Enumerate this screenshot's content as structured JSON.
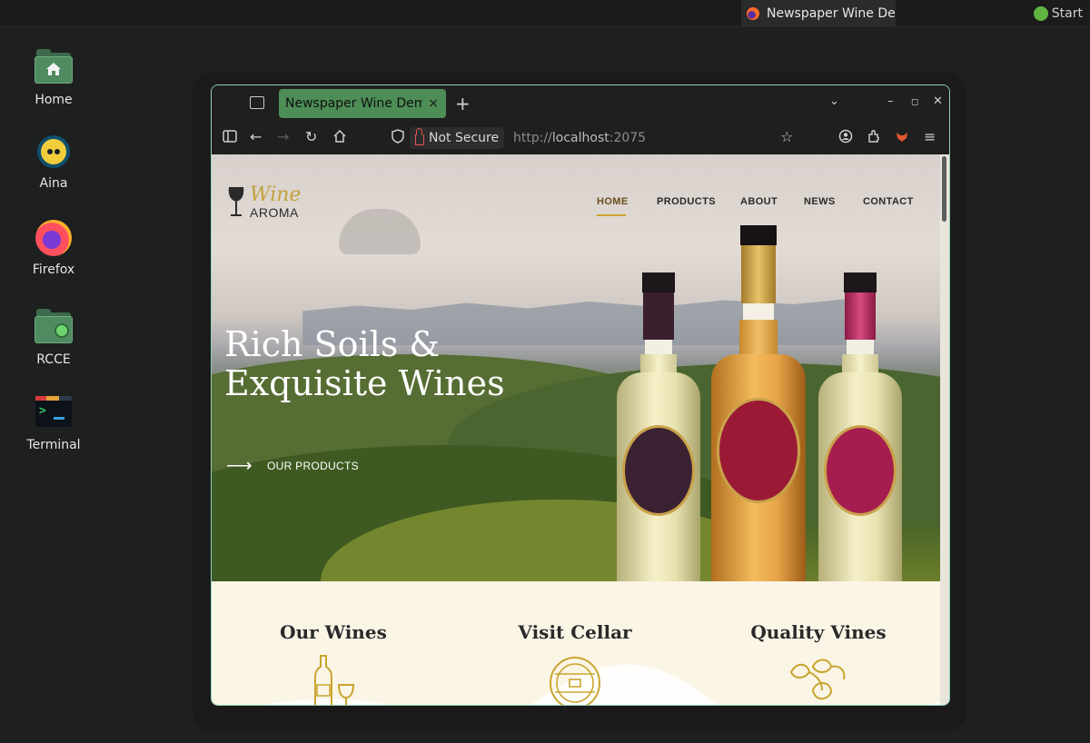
{
  "top_panel": {
    "taskbar_title": "Newspaper Wine De...",
    "start_label": "Start"
  },
  "desktop": {
    "icons": [
      {
        "label": "Home",
        "icon": "home-folder-icon"
      },
      {
        "label": "Aina",
        "icon": "aina-icon"
      },
      {
        "label": "Firefox",
        "icon": "firefox-icon"
      },
      {
        "label": "RCCE",
        "icon": "rcce-folder-icon"
      },
      {
        "label": "Terminal",
        "icon": "terminal-icon"
      }
    ]
  },
  "browser": {
    "tab_title": "Newspaper Wine Demo",
    "tab_close": "×",
    "new_tab": "+",
    "security_label": "Not Secure",
    "url_scheme": "http://",
    "url_host": "localhost",
    "url_port": ":2075",
    "accent": "#4d8d56"
  },
  "site": {
    "logo": {
      "word1": "Wine",
      "word2": "AROMA"
    },
    "nav": [
      "HOME",
      "PRODUCTS",
      "ABOUT",
      "NEWS",
      "CONTACT"
    ],
    "active_nav": "HOME",
    "hero": {
      "title_line1": "Rich Soils &",
      "title_line2": "Exquisite Wines",
      "cta": "OUR PRODUCTS"
    },
    "features": [
      {
        "title": "Our Wines",
        "icon": "wine-bottle-glass-icon"
      },
      {
        "title": "Visit Cellar",
        "icon": "barrel-icon"
      },
      {
        "title": "Quality Vines",
        "icon": "vine-leaves-icon"
      }
    ],
    "colors": {
      "gold": "#c9a52f",
      "cream": "#fbf5e6"
    }
  }
}
